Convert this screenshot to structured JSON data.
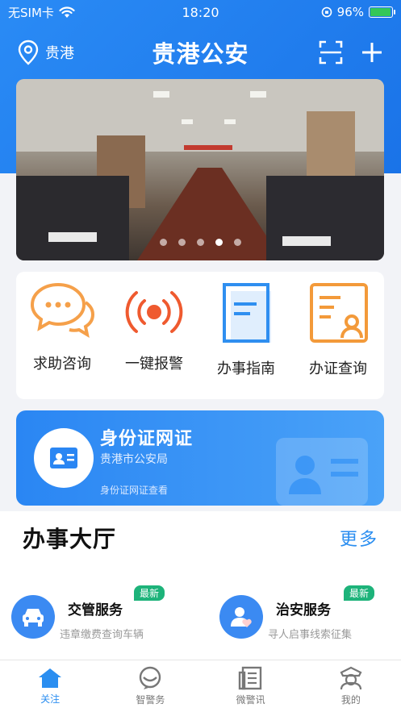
{
  "status": {
    "carrier": "无SIM卡",
    "time": "18:20",
    "battery": "96%",
    "battery_level": 0.96
  },
  "nav": {
    "location": "贵港",
    "title": "贵港公安"
  },
  "banner": {
    "dots": 5,
    "active_index": 3
  },
  "quick": [
    {
      "label": "求助咨询",
      "icon": "chat-bubbles-icon",
      "color": "#f5a04a"
    },
    {
      "label": "一键报警",
      "icon": "alarm-broadcast-icon",
      "color": "#ef5a2f"
    },
    {
      "label": "办事指南",
      "icon": "guide-document-icon",
      "color": "#2f8ff0"
    },
    {
      "label": "办证查询",
      "icon": "certificate-search-icon",
      "color": "#f39a3a"
    }
  ],
  "id_card": {
    "title": "身份证网证",
    "subtitle": "贵港市公安局",
    "link": "身份证网证查看"
  },
  "section": {
    "title": "办事大厅",
    "more": "更多"
  },
  "services": [
    {
      "name": "交管服务",
      "desc": "违章缴费查询车辆",
      "badge": "最新",
      "icon": "car-icon"
    },
    {
      "name": "治安服务",
      "desc": "寻人启事线索征集",
      "badge": "最新",
      "icon": "person-heart-icon"
    }
  ],
  "tabs": [
    {
      "label": "关注",
      "icon": "home-icon",
      "active": true
    },
    {
      "label": "智警务",
      "icon": "police-chat-icon",
      "active": false
    },
    {
      "label": "微警讯",
      "icon": "news-icon",
      "active": false
    },
    {
      "label": "我的",
      "icon": "officer-profile-icon",
      "active": false
    }
  ],
  "colors": {
    "brand": "#1a73e8",
    "accent_text": "#2b8ef0",
    "badge": "#1db37a"
  }
}
